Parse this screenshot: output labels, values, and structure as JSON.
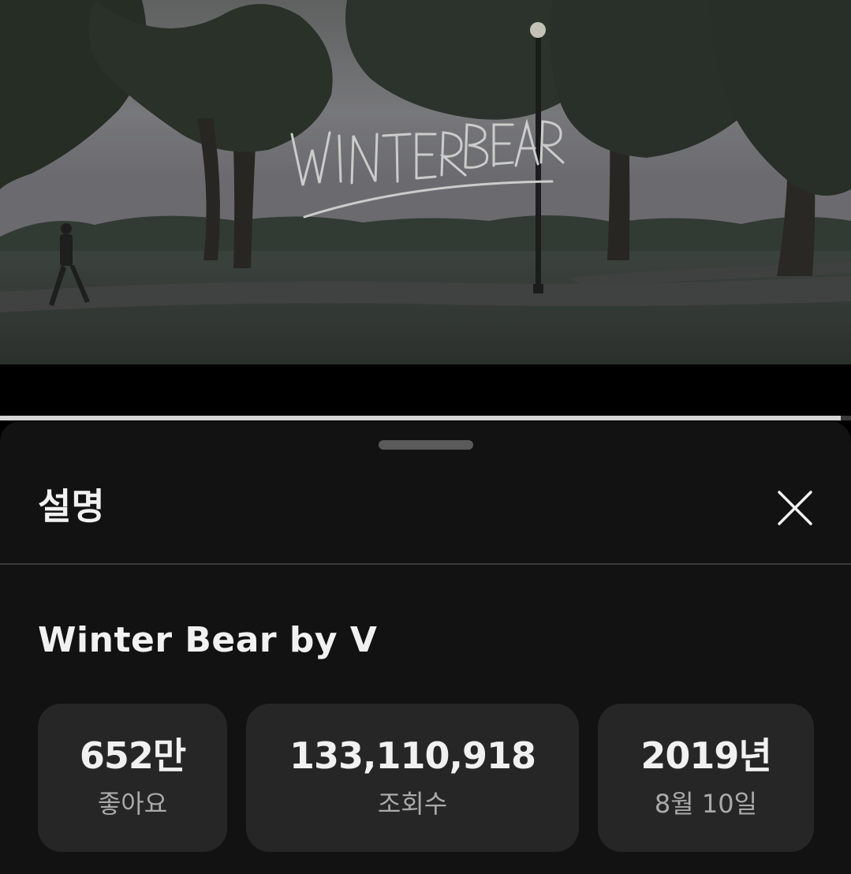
{
  "video": {
    "overlay_title": "WINTER BEAR",
    "progress_percent": 98.8,
    "colors": {
      "sky": "#8a8a8e",
      "grass": "#3b423c",
      "trees": "#2a322b"
    }
  },
  "sheet": {
    "title": "설명",
    "close_icon": "close-icon",
    "video_title": "Winter Bear by V",
    "stats": {
      "likes": {
        "value": "652만",
        "label": "좋아요"
      },
      "views": {
        "value": "133,110,918",
        "label": "조회수"
      },
      "date": {
        "value": "2019년",
        "label": "8월 10일"
      }
    },
    "colors": {
      "background": "#121212",
      "card": "#262626",
      "text": "#f1f1f1",
      "subtext": "#aaaaaa"
    }
  }
}
